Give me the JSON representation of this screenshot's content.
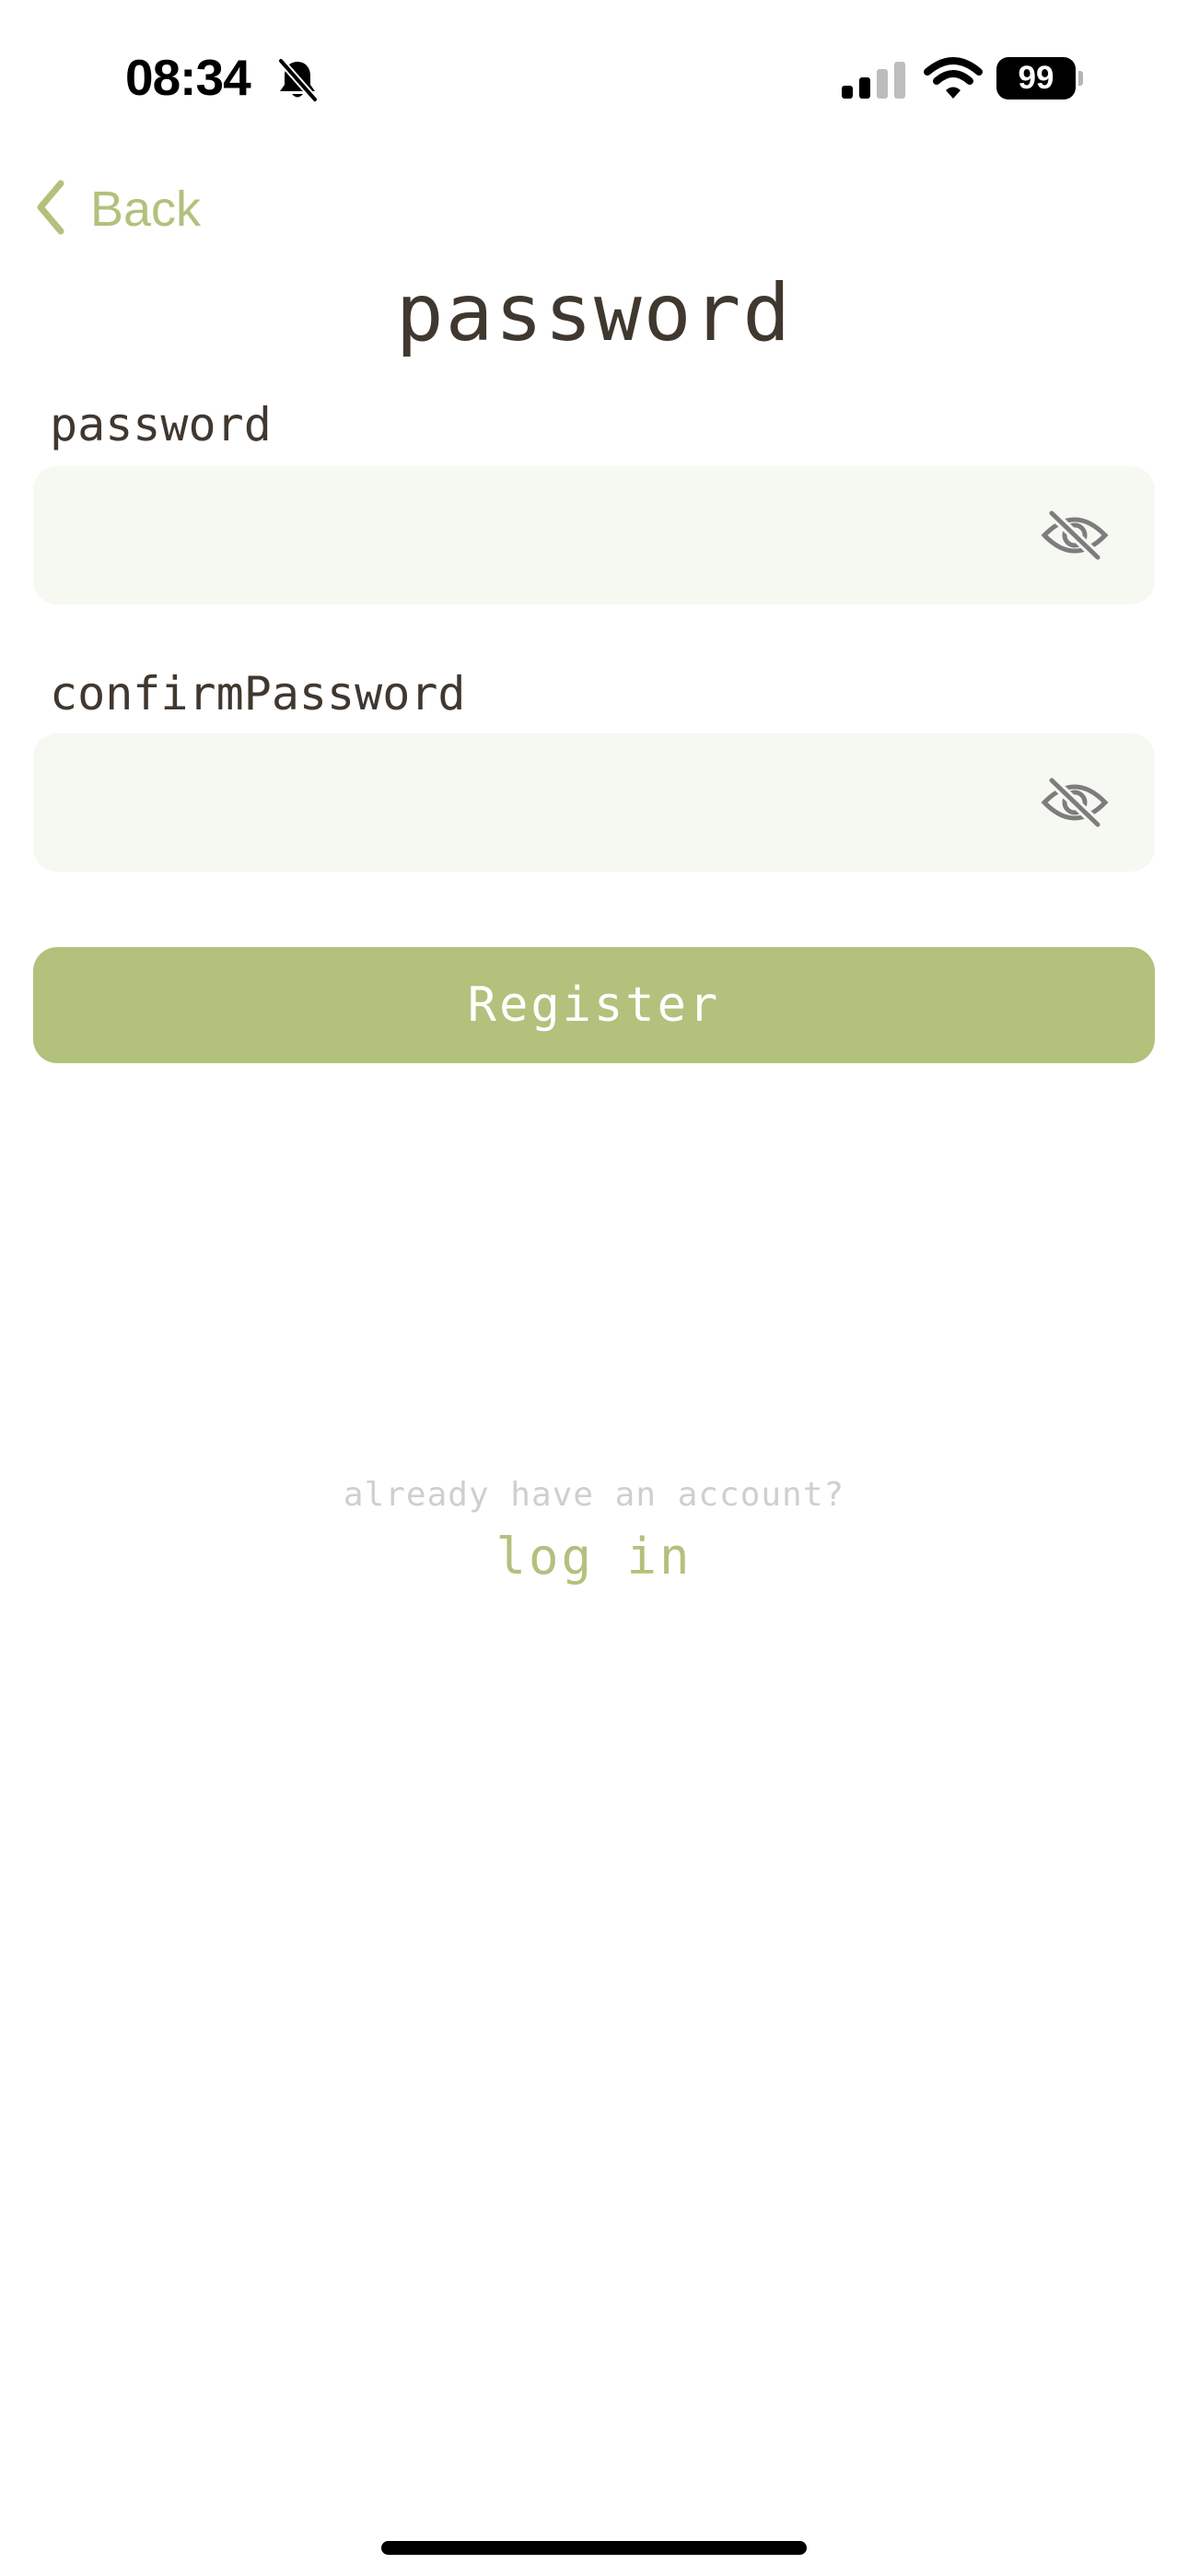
{
  "status_bar": {
    "time": "08:34",
    "battery_level": "99",
    "icons": [
      "bell-slash-icon",
      "cellular-signal-icon",
      "wifi-icon",
      "battery-icon"
    ]
  },
  "nav": {
    "back_label": "Back",
    "back_icon": "chevron-left-icon"
  },
  "page": {
    "title": "password"
  },
  "form": {
    "password": {
      "label": "password",
      "value": "",
      "toggle_icon": "eye-slash-icon"
    },
    "confirm_password": {
      "label": "confirmPassword",
      "value": "",
      "toggle_icon": "eye-slash-icon"
    },
    "submit_label": "Register"
  },
  "footer": {
    "prompt": "already have an account?",
    "login_label": "log in"
  },
  "colors": {
    "accent": "#b2c17c",
    "text": "#40372f",
    "input_background": "#f6f8f2",
    "muted_text": "#cfcfcf"
  }
}
